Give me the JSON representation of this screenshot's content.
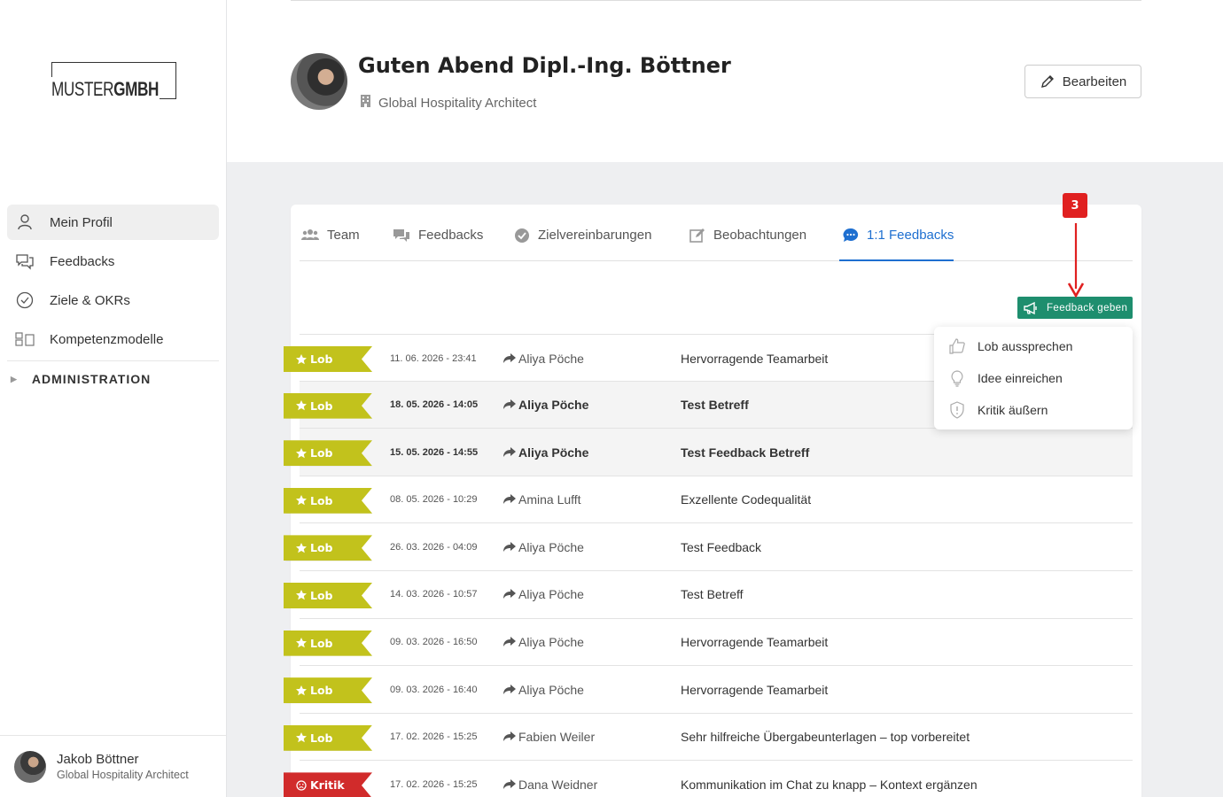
{
  "brand": {
    "logo_light": "MUSTER",
    "logo_bold": "GMBH"
  },
  "sidebar": {
    "items": [
      {
        "label": "Mein Profil",
        "icon": "user-icon",
        "active": true
      },
      {
        "label": "Feedbacks",
        "icon": "chat-icon"
      },
      {
        "label": "Ziele & OKRs",
        "icon": "check-circle-icon"
      },
      {
        "label": "Kompetenzmodelle",
        "icon": "grid-icon"
      }
    ],
    "admin_label": "ADMINISTRATION"
  },
  "user": {
    "name": "Jakob Böttner",
    "role": "Global Hospitality Architect"
  },
  "header": {
    "greeting": "Guten Abend Dipl.-Ing. Böttner",
    "role": "Global Hospitality Architect",
    "edit_label": "Bearbeiten"
  },
  "tabs": [
    {
      "label": "Team",
      "icon": "users-icon"
    },
    {
      "label": "Feedbacks",
      "icon": "comments-icon"
    },
    {
      "label": "Zielvereinbarungen",
      "icon": "check-circle-icon"
    },
    {
      "label": "Beobachtungen",
      "icon": "edit-icon"
    },
    {
      "label": "1:1 Feedbacks",
      "icon": "chat-bubble-icon",
      "active": true
    }
  ],
  "feedback_button": "Feedback geben",
  "annotation_badge": "3",
  "dropdown": [
    {
      "label": "Lob aussprechen",
      "icon": "thumbs-up-icon"
    },
    {
      "label": "Idee einreichen",
      "icon": "lightbulb-icon"
    },
    {
      "label": "Kritik äußern",
      "icon": "shield-icon"
    }
  ],
  "rows": [
    {
      "type": "Lob",
      "date": "11. 06. 2026 - 23:41",
      "from": "Aliya Pöche",
      "subject": "Hervorragende Teamarbeit"
    },
    {
      "type": "Lob",
      "date": "18. 05. 2026 - 14:05",
      "from": "Aliya Pöche",
      "subject": "Test Betreff"
    },
    {
      "type": "Lob",
      "date": "15. 05. 2026 - 14:55",
      "from": "Aliya Pöche",
      "subject": "Test Feedback Betreff"
    },
    {
      "type": "Lob",
      "date": "08. 05. 2026 - 10:29",
      "from": "Amina Lufft",
      "subject": "Exzellente Codequalität"
    },
    {
      "type": "Lob",
      "date": "26. 03. 2026 - 04:09",
      "from": "Aliya Pöche",
      "subject": "Test Feedback"
    },
    {
      "type": "Lob",
      "date": "14. 03. 2026 - 10:57",
      "from": "Aliya Pöche",
      "subject": "Test Betreff"
    },
    {
      "type": "Lob",
      "date": "09. 03. 2026 - 16:50",
      "from": "Aliya Pöche",
      "subject": "Hervorragende Teamarbeit"
    },
    {
      "type": "Lob",
      "date": "09. 03. 2026 - 16:40",
      "from": "Aliya Pöche",
      "subject": "Hervorragende Teamarbeit"
    },
    {
      "type": "Lob",
      "date": "17. 02. 2026 - 15:25",
      "from": "Fabien Weiler",
      "subject": "Sehr hilfreiche Übergabeunterlagen – top vorbereitet"
    },
    {
      "type": "Kritik",
      "date": "17. 02. 2026 - 15:25",
      "from": "Dana Weidner",
      "subject": "Kommunikation im Chat zu knapp – Kontext ergänzen"
    }
  ],
  "colors": {
    "lob": "#c2c21c",
    "kritik": "#d12b2b",
    "accent": "#1e6fd0",
    "feedback_button": "#1e8e6e",
    "annotation": "#e02020"
  }
}
